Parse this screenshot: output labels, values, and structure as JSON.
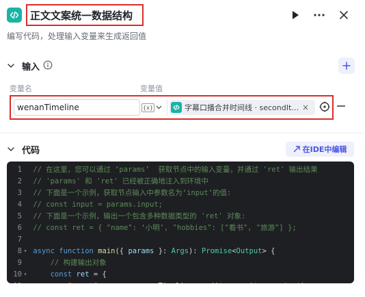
{
  "node": {
    "title": "正文文案统一数据结构",
    "subtitle": "编写代码，处理输入变量来生成返回值"
  },
  "input_section": {
    "title": "输入",
    "col_name": "变量名",
    "col_value": "变量值",
    "rows": [
      {
        "name": "wenanTimeline",
        "type_label": "{x}",
        "ref_label": "字幕口播合并时间线 · secondIt…"
      }
    ]
  },
  "code_section": {
    "title": "代码",
    "ide_label": "在IDE中编辑",
    "lines": [
      {
        "n": "1",
        "fold": "",
        "text": " // 在这里，您可以通过 ‘params’  获取节点中的输入变量，并通过 'ret' 输出结果",
        "cls": "c-com"
      },
      {
        "n": "2",
        "fold": "",
        "text": " // 'params' 和 'ret' 已经被正确地注入到环境中",
        "cls": "c-com"
      },
      {
        "n": "3",
        "fold": "",
        "text": " // 下面是一个示例，获取节点输入中参数名为‘input’的值:",
        "cls": "c-com"
      },
      {
        "n": "4",
        "fold": "",
        "text": " // const input = params.input;",
        "cls": "c-com"
      },
      {
        "n": "5",
        "fold": "",
        "text": " // 下面是一个示例，输出一个包含多种数据类型的 'ret' 对象:",
        "cls": "c-com"
      },
      {
        "n": "6",
        "fold": "",
        "text": " // const ret = { \"name\": ‘小明’, \"hobbies\": [\"看书\", \"旅游\"] };",
        "cls": "c-com"
      },
      {
        "n": "7",
        "fold": "",
        "text": "",
        "cls": "c-pl"
      },
      {
        "n": "8",
        "fold": "▾",
        "text": "",
        "cls": "c-pl"
      },
      {
        "n": "9",
        "fold": "",
        "text": "     // 构建输出对象",
        "cls": "c-com"
      },
      {
        "n": "10",
        "fold": "▾",
        "text": "",
        "cls": "c-pl"
      },
      {
        "n": "11",
        "fold": "",
        "text": "",
        "cls": "c-pl"
      }
    ],
    "line8": {
      "kw1": "async",
      "kw2": "function",
      "fn": "main",
      "p1": "({ ",
      "var": "params",
      "p2": " }: ",
      "ty1": "Args",
      "p3": "): ",
      "ty2": "Promise",
      "p4": "<",
      "ty3": "Output",
      "p5": "> {"
    },
    "line10": {
      "kw": "const",
      "var": "ret",
      "p": " = {"
    },
    "line11": {
      "str": "\"scrpt\"",
      "p": ": params.wenanTimeline.map(item => item.content)"
    }
  }
}
